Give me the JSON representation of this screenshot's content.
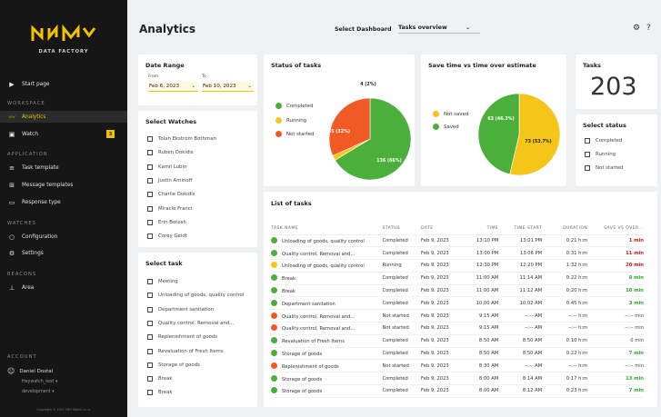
{
  "sidebar": {
    "brand": "DATA FACTORY",
    "start_page": "Start page",
    "sections": {
      "workspace": "WORKSPACE",
      "application": "APPLICATION",
      "watches": "WATCHES",
      "beacons": "BEACONS",
      "account": "ACCOUNT"
    },
    "workspace_items": [
      {
        "label": "Analytics",
        "icon": "chart-line-icon"
      },
      {
        "label": "Watch",
        "icon": "watch-icon",
        "badge": "3"
      }
    ],
    "application_items": [
      {
        "label": "Task template",
        "icon": "list-icon"
      },
      {
        "label": "Message templates",
        "icon": "message-plus-icon"
      },
      {
        "label": "Response type",
        "icon": "response-icon"
      }
    ],
    "watches_items": [
      {
        "label": "Configuration",
        "icon": "configuration-icon"
      },
      {
        "label": "Settings",
        "icon": "settings-icon"
      }
    ],
    "beacons_items": [
      {
        "label": "Area",
        "icon": "pin-icon"
      }
    ],
    "account": {
      "name": "Daniel Dostal",
      "org": "Heywatch_test",
      "env": "development"
    },
    "copyright": "Copyright © 2021 HEY Watch s.r.o."
  },
  "header": {
    "title": "Analytics",
    "select_label": "Select Dashboard",
    "selected": "Tasks overview"
  },
  "date_range": {
    "title": "Date Range",
    "from_label": "From",
    "from": "Feb 6, 2023",
    "to_label": "To",
    "to": "Feb 10, 2023"
  },
  "watches": {
    "title": "Select Watches",
    "items": [
      "Tolan Ekstrom Bothman",
      "Ruben Dokidis",
      "Kamil Lubin",
      "Justin Aminoff",
      "Charlie Dokidis",
      "Miracle Franci",
      "Erin Botosh",
      "Corey Geidt"
    ]
  },
  "tasks_select": {
    "title": "Select task",
    "items": [
      "Meeting",
      "Unloading of goods, quality control",
      "Department sanitation",
      "Quality control, Removal and...",
      "Replenishment of goods",
      "Revaluation of Fresh Items",
      "Storage of goods",
      "Break",
      "Break"
    ]
  },
  "status_chart": {
    "title": "Status of tasks",
    "legend": [
      "Completed",
      "Running",
      "Not started"
    ],
    "labels": {
      "completed": "136 (66%)",
      "running": "4 (2%)",
      "not_started": "65 (32%)"
    }
  },
  "save_chart": {
    "title": "Save time vs time over estimate",
    "legend": [
      "Not saved",
      "Saved"
    ],
    "labels": {
      "saved": "63 (46.3%)",
      "not_saved": "73 (53.7%)"
    }
  },
  "chart_data": [
    {
      "type": "pie",
      "title": "Status of tasks",
      "categories": [
        "Completed",
        "Running",
        "Not started"
      ],
      "values": [
        136,
        4,
        65
      ],
      "colors": [
        "#4caf3c",
        "#f5c518",
        "#f05a24"
      ]
    },
    {
      "type": "pie",
      "title": "Save time vs time over estimate",
      "categories": [
        "Not saved",
        "Saved"
      ],
      "values": [
        73,
        63
      ],
      "colors": [
        "#f5c518",
        "#4caf3c"
      ]
    }
  ],
  "tasks_count": {
    "title": "Tasks",
    "value": "203"
  },
  "status_select": {
    "title": "Select status",
    "items": [
      "Completed",
      "Running",
      "Not started"
    ]
  },
  "list": {
    "title": "List of tasks",
    "columns": [
      "TASK NAME",
      "STATUS",
      "DATE",
      "TIME",
      "TIME START",
      "DURATION",
      "SAVE VS OVER..."
    ],
    "rows": [
      {
        "c": "#4caf3c",
        "name": "Unloading of goods, quality control",
        "status": "Completed",
        "date": "Feb 9, 2023",
        "time": "13:10 PM",
        "start": "13:01 PM",
        "dur": "0:21 h:m",
        "save": "1 min",
        "sc": "rd"
      },
      {
        "c": "#4caf3c",
        "name": "Quality control, Removal and...",
        "status": "Completed",
        "date": "Feb 9, 2023",
        "time": "13:00 PM",
        "start": "13:06 PM",
        "dur": "0:31 h:m",
        "save": "11 min",
        "sc": "rd"
      },
      {
        "c": "#f5c518",
        "name": "Unloading of goods, quality control",
        "status": "Running",
        "date": "Feb 9, 2023",
        "time": "12:30 PM",
        "start": "12:20 PM",
        "dur": "1:32 h:m",
        "save": "20 min",
        "sc": "rd"
      },
      {
        "c": "#4caf3c",
        "name": "Break",
        "status": "Completed",
        "date": "Feb 9, 2023",
        "time": "11:00 AM",
        "start": "11:14 AM",
        "dur": "0:22 h:m",
        "save": "8 min",
        "sc": "g"
      },
      {
        "c": "#4caf3c",
        "name": "Break",
        "status": "Completed",
        "date": "Feb 9, 2023",
        "time": "11:00 AM",
        "start": "11:12 AM",
        "dur": "0:20 h:m",
        "save": "10 min",
        "sc": "g"
      },
      {
        "c": "#4caf3c",
        "name": "Department sanitation",
        "status": "Completed",
        "date": "Feb 9, 2023",
        "time": "10:00 AM",
        "start": "10:02 AM",
        "dur": "0:45 h:m",
        "save": "3 min",
        "sc": "g"
      },
      {
        "c": "#f05a24",
        "name": "Quality control, Removal and...",
        "status": "Not started",
        "date": "Feb 9, 2023",
        "time": "9:15 AM",
        "start": "--:-- AM",
        "dur": "--:-- h:m",
        "save": "--:-- min",
        "sc": "gy"
      },
      {
        "c": "#f05a24",
        "name": "Quality control, Removal and...",
        "status": "Not started",
        "date": "Feb 9, 2023",
        "time": "9:15 AM",
        "start": "--:-- AM",
        "dur": "--:-- h:m",
        "save": "--:-- min",
        "sc": "gy"
      },
      {
        "c": "#4caf3c",
        "name": "Revaluation of Fresh Items",
        "status": "Completed",
        "date": "Feb 9, 2023",
        "time": "8:50 AM",
        "start": "8:50 AM",
        "dur": "0:10 h:m",
        "save": "0 min",
        "sc": "gy"
      },
      {
        "c": "#4caf3c",
        "name": "Storage of goods",
        "status": "Completed",
        "date": "Feb 9, 2023",
        "time": "8:50 AM",
        "start": "8:50 AM",
        "dur": "0:22 h:m",
        "save": "7 min",
        "sc": "g"
      },
      {
        "c": "#f05a24",
        "name": "Replenishment of goods",
        "status": "Not started",
        "date": "Feb 9, 2023",
        "time": "8:30 AM",
        "start": "--:-- AM",
        "dur": "--:-- h:m",
        "save": "--:-- min",
        "sc": "gy"
      },
      {
        "c": "#4caf3c",
        "name": "Storage of goods",
        "status": "Completed",
        "date": "Feb 9, 2023",
        "time": "8:00 AM",
        "start": "8:14 AM",
        "dur": "0:17 h:m",
        "save": "13 min",
        "sc": "g"
      },
      {
        "c": "#4caf3c",
        "name": "Storage of goods",
        "status": "Completed",
        "date": "Feb 9, 2023",
        "time": "8:00 AM",
        "start": "8:12 AM",
        "dur": "0:23 h:m",
        "save": "7 min",
        "sc": "g"
      }
    ]
  }
}
